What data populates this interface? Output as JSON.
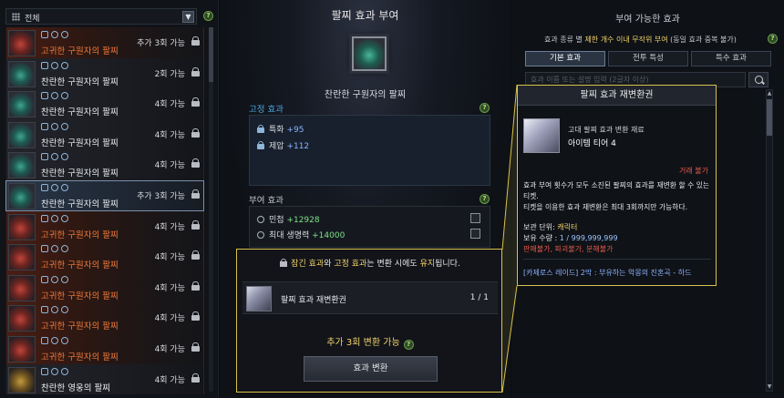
{
  "left_panel": {
    "filter_label": "전체",
    "items": [
      {
        "name": "고귀한 구원자의 팔찌",
        "count": "추가 3회 가능",
        "grade": "rare"
      },
      {
        "name": "찬란한 구원자의 팔찌",
        "count": "2회 가능",
        "grade": "heroic"
      },
      {
        "name": "찬란한 구원자의 팔찌",
        "count": "4회 가능",
        "grade": "heroic"
      },
      {
        "name": "찬란한 구원자의 팔찌",
        "count": "4회 가능",
        "grade": "heroic"
      },
      {
        "name": "찬란한 구원자의 팔찌",
        "count": "4회 가능",
        "grade": "heroic"
      },
      {
        "name": "찬란한 구원자의 팔찌",
        "count": "추가 3회 가능",
        "grade": "selected"
      },
      {
        "name": "고귀한 구원자의 팔찌",
        "count": "4회 가능",
        "grade": "rare"
      },
      {
        "name": "고귀한 구원자의 팔찌",
        "count": "4회 가능",
        "grade": "rare"
      },
      {
        "name": "고귀한 구원자의 팔찌",
        "count": "4회 가능",
        "grade": "rare"
      },
      {
        "name": "고귀한 구원자의 팔찌",
        "count": "4회 가능",
        "grade": "rare"
      },
      {
        "name": "고귀한 구원자의 팔찌",
        "count": "4회 가능",
        "grade": "rare"
      },
      {
        "name": "찬란한 영웅의 팔찌",
        "count": "4회 가능",
        "grade": "gold"
      }
    ]
  },
  "center": {
    "title": "팔찌 효과 부여",
    "item_name": "찬란한 구원자의 팔찌",
    "fixed_label": "고정 효과",
    "fixed_effects": [
      {
        "name": "특화",
        "value": "+95"
      },
      {
        "name": "제압",
        "value": "+112"
      }
    ],
    "grant_label": "부여 효과",
    "grant_effects": [
      {
        "name": "민첩",
        "value": "+12928"
      },
      {
        "name": "최대 생명력",
        "value": "+14000"
      }
    ]
  },
  "convert": {
    "note_part1": "잠긴 효과",
    "note_part2": "와 ",
    "note_part3": "고정 효과",
    "note_part4": "는 변환 시에도 ",
    "note_part5": "유지",
    "note_part6": "됩니다.",
    "ticket_name": "팔찌 효과 재변환권",
    "ticket_count": "1 / 1",
    "remain": "추가 3회 변환 가능",
    "button": "효과 변환"
  },
  "right_panel": {
    "title": "부여 가능한 효과",
    "note_a": "효과 종류 별 ",
    "note_b": "제한 개수 이내 무작위 부여",
    "note_c": " (동일 효과 중복 불가)",
    "tabs": [
      "기본 효과",
      "전투 특성",
      "특수 효과"
    ],
    "search_placeholder": "효과 이름 또는 설명 입력 (2글자 이상)"
  },
  "tooltip": {
    "title": "팔찌 효과 재변환권",
    "grade": "고대 팔찌 효과 변환 재료",
    "tier": "아이템 티어 4",
    "trade": "거래 불가",
    "desc_1": "효과 부여 횟수가 모두 소진된 팔찌의 효과를 재변환 할 수 있는 티켓.",
    "desc_2": "티켓을 이용한 효과 재변환은 최대 3회까지만 가능하다.",
    "unit_label": "보관 단위: ",
    "unit_value": "캐릭터",
    "qty_label": "보유 수량 : ",
    "qty_value": "1 / 999,999,999",
    "restrict": "판매불가, 파괴불가, 분해불가",
    "source": "[카제로스 레이드] 2막 : 부유하는 악몽의 진혼곡 - 하드"
  }
}
